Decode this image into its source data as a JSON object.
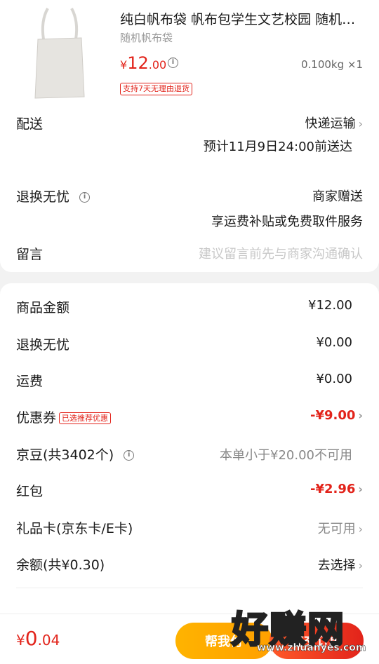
{
  "product": {
    "title": "纯白帆布袋 帆布包学生文艺校园 随机…",
    "spec": "随机帆布袋",
    "price_currency": "¥",
    "price_int": "12",
    "price_dec": ".00",
    "weight_qty": "0.100kg ×1",
    "return_badge": "支持7天无理由退货"
  },
  "shipping": {
    "label": "配送",
    "method": "快递运输",
    "eta": "预计11月9日24:00前送达"
  },
  "worry_free": {
    "label": "退换无忧",
    "value": "商家赠送",
    "desc": "享运费补贴或免费取件服务"
  },
  "message": {
    "label": "留言",
    "placeholder": "建议留言前先与商家沟通确认"
  },
  "fees": {
    "goods_label": "商品金额",
    "goods_value": "¥12.00",
    "worry_label": "退换无忧",
    "worry_value": "¥0.00",
    "freight_label": "运费",
    "freight_value": "¥0.00",
    "coupon_label": "优惠券",
    "coupon_tag": "已选推荐优惠",
    "coupon_value": "-¥9.00",
    "jingdou_label": "京豆(共3402个)",
    "jingdou_value": "本单小于¥20.00不可用",
    "redpacket_label": "红包",
    "redpacket_value": "-¥2.96",
    "giftcard_label": "礼品卡(京东卡/E卡)",
    "giftcard_value": "无可用",
    "balance_label": "余额(共¥0.30)",
    "balance_value": "去选择"
  },
  "footer": {
    "total_currency": "¥",
    "total_int": "0",
    "total_dec": ".04",
    "pay_for_label": "帮我付",
    "submit_label": "提交订单"
  },
  "watermark": {
    "text": "好赚网",
    "url": "www.zhuanyes.com"
  },
  "colors": {
    "accent_red": "#e2231a",
    "accent_orange": "#ffa000"
  }
}
